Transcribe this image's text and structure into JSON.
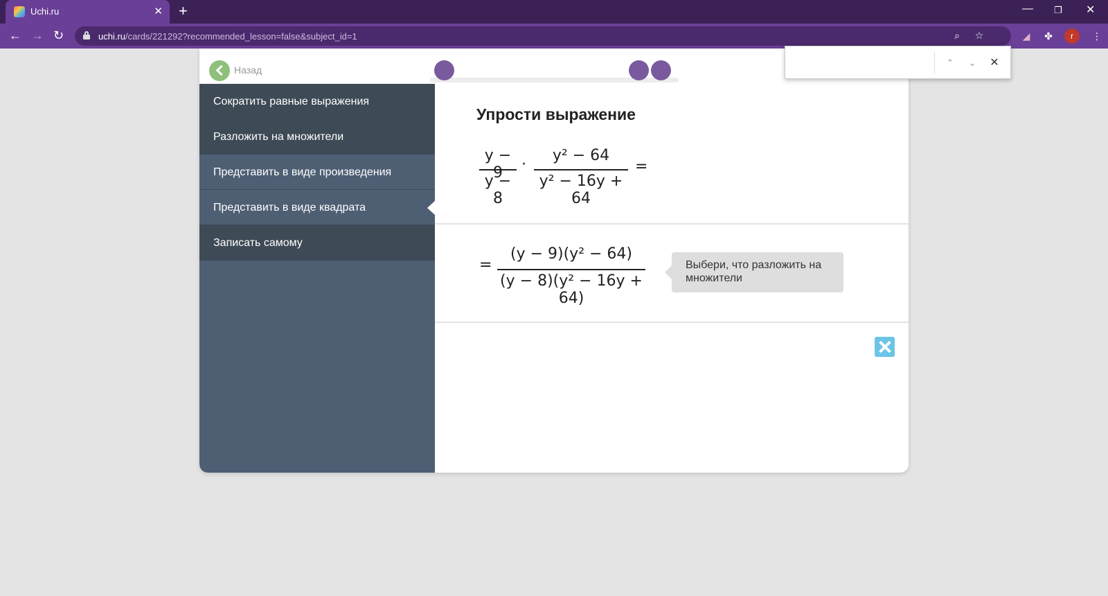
{
  "browser": {
    "tab_title": "Uchi.ru",
    "tab_close": "✕",
    "new_tab": "+",
    "url_host": "uchi.ru",
    "url_path": "/cards/221292?recommended_lesson=false&subject_id=1",
    "avatar_letter": "r",
    "win_minimize": "—",
    "win_restore": "❐",
    "win_close": "✕"
  },
  "findbar": {
    "value": "",
    "prev": "⌃",
    "next": "⌄",
    "close": "✕"
  },
  "card": {
    "back_label": "Назад",
    "progress": {
      "dots": 3
    }
  },
  "sidebar": {
    "items": [
      {
        "label": "Сократить равные выражения"
      },
      {
        "label": "Разложить на множители"
      },
      {
        "label": "Представить в виде произведения"
      },
      {
        "label": "Представить в виде квадрата"
      },
      {
        "label": "Записать самому"
      }
    ]
  },
  "task": {
    "title": "Упрости выражение",
    "expr1": {
      "frac1_num": "y − 9",
      "frac1_den": "y − 8",
      "dot": "·",
      "frac2_num": "y² − 64",
      "frac2_den": "y² − 16y + 64",
      "equals": "="
    },
    "expr2": {
      "equals": "=",
      "num": "(y − 9)(y² − 64)",
      "den": "(y − 8)(y² − 16y + 64)"
    },
    "hint": "Выбери, что разложить на множители"
  }
}
